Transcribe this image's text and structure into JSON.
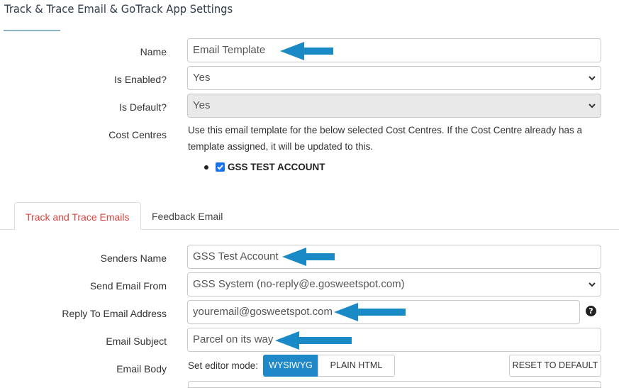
{
  "header": {
    "title": "Track & Trace Email & GoTrack App Settings"
  },
  "settings": {
    "name": {
      "label": "Name",
      "value": "Email Template"
    },
    "is_enabled": {
      "label": "Is Enabled?",
      "value": "Yes"
    },
    "is_default": {
      "label": "Is Default?",
      "value": "Yes"
    },
    "cost_centres": {
      "label": "Cost Centres",
      "description": "Use this email template for the below selected Cost Centres. If the Cost Centre already has a template assigned, it will be updated to this.",
      "items": [
        {
          "label": "GSS TEST ACCOUNT",
          "checked": true
        }
      ]
    }
  },
  "tabs": [
    {
      "label": "Track and Trace Emails",
      "active": true
    },
    {
      "label": "Feedback Email",
      "active": false
    }
  ],
  "email": {
    "senders_name": {
      "label": "Senders Name",
      "value": "GSS Test Account"
    },
    "send_from": {
      "label": "Send Email From",
      "value": "GSS System (no-reply@e.gosweetspot.com)"
    },
    "reply_to": {
      "label": "Reply To Email Address",
      "value": "youremail@gosweetspot.com"
    },
    "subject": {
      "label": "Email Subject",
      "value": "Parcel on its way"
    },
    "body": {
      "label": "Email Body",
      "mode_label": "Set editor mode:",
      "wysiwyg_label": "WYSIWYG",
      "plain_html_label": "PLAIN HTML",
      "reset_label": "RESET TO DEFAULT"
    }
  },
  "icons": {
    "help": "question-circle-icon",
    "select": "chevron-down-icon",
    "annotation": "left-arrow-icon"
  },
  "colors": {
    "accent": "#1e88c8",
    "active_tab": "#d9423c",
    "annotation_arrow": "#1a8ac6"
  }
}
